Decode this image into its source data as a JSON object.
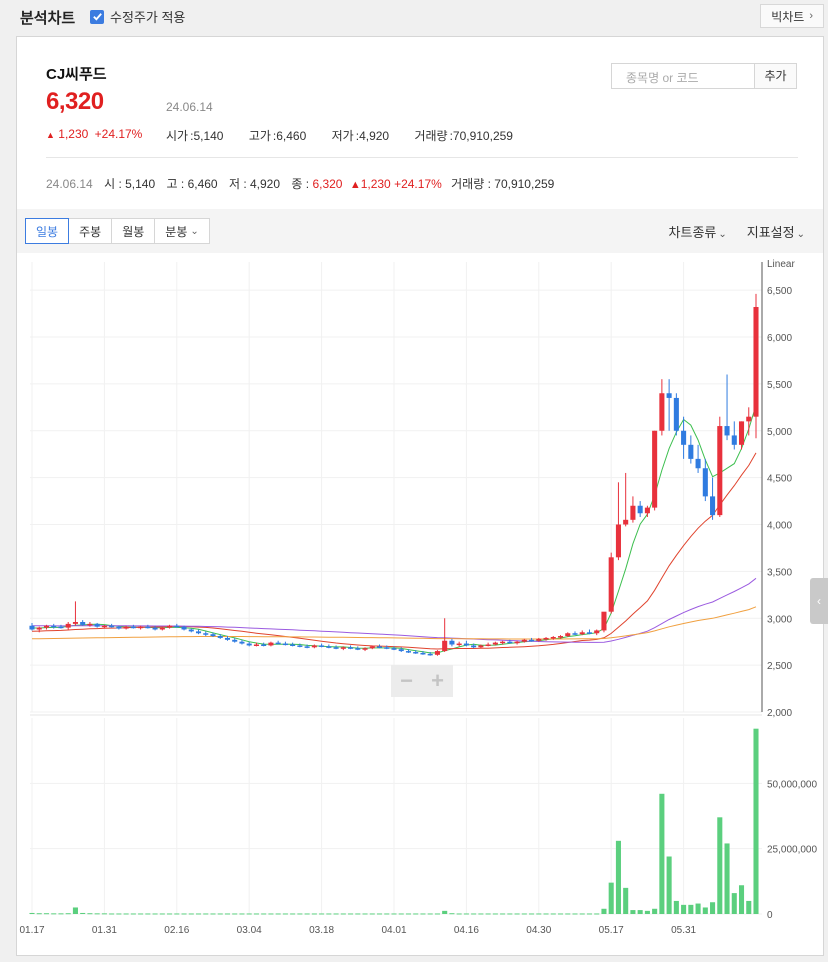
{
  "header": {
    "title": "분석차트",
    "adjusted_label": "수정주가 적용",
    "adjusted_checked": true,
    "bigchart_label": "빅차트"
  },
  "stock": {
    "name": "CJ씨푸드",
    "price": "6,320",
    "date": "24.06.14",
    "change": "1,230",
    "change_pct": "+24.17%",
    "open_label": "시가",
    "open": "5,140",
    "high_label": "고가",
    "high": "6,460",
    "low_label": "저가",
    "low": "4,920",
    "volume_label": "거래량",
    "volume": "70,910,259"
  },
  "search": {
    "placeholder": "종목명 or 코드",
    "add_label": "추가"
  },
  "ohlc_line": {
    "date": "24.06.14",
    "o_label": "시",
    "o": "5,140",
    "h_label": "고",
    "h": "6,460",
    "l_label": "저",
    "l": "4,920",
    "c_label": "종",
    "c": "6,320",
    "change": "1,230",
    "change_pct": "+24.17%",
    "v_label": "거래량",
    "v": "70,910,259"
  },
  "toolbar": {
    "periods": [
      "일봉",
      "주봉",
      "월봉",
      "분봉"
    ],
    "active_period": "일봉",
    "chart_type_label": "차트종류",
    "indicator_label": "지표설정"
  },
  "colors": {
    "up": "#e8313c",
    "down": "#2f7be0",
    "volume": "#5bcf7e",
    "ma5": "#3dbf4f",
    "ma20": "#e0442e",
    "ma60": "#9b5be0",
    "ma120": "#f0a040"
  },
  "chart_data": {
    "type": "candlestick",
    "scale_label": "Linear",
    "price_ticks": [
      2000,
      2500,
      3000,
      3500,
      4000,
      4500,
      5000,
      5500,
      6000,
      6500
    ],
    "price_tick_labels": [
      "2,000",
      "2,500",
      "3,000",
      "3,500",
      "4,000",
      "4,500",
      "5,000",
      "5,500",
      "6,000",
      "6,500"
    ],
    "ylim": [
      2000,
      6800
    ],
    "volume_ticks": [
      0,
      25000000,
      50000000
    ],
    "volume_tick_labels": [
      "0",
      "25,000,000",
      "50,000,000"
    ],
    "volume_ylim": [
      0,
      75000000
    ],
    "x_tick_labels": [
      "01.17",
      "01.31",
      "02.16",
      "03.04",
      "03.18",
      "04.01",
      "04.16",
      "04.30",
      "05.17",
      "05.31"
    ],
    "x_tick_index": [
      0,
      10,
      20,
      30,
      40,
      50,
      60,
      70,
      80,
      90
    ],
    "candles": [
      [
        2920,
        2950,
        2870,
        2880
      ],
      [
        2880,
        2910,
        2850,
        2900
      ],
      [
        2900,
        2930,
        2880,
        2920
      ],
      [
        2920,
        2940,
        2890,
        2910
      ],
      [
        2910,
        2930,
        2890,
        2900
      ],
      [
        2900,
        2960,
        2880,
        2940
      ],
      [
        2940,
        3180,
        2920,
        2960
      ],
      [
        2960,
        2980,
        2920,
        2930
      ],
      [
        2930,
        2960,
        2910,
        2940
      ],
      [
        2940,
        2950,
        2900,
        2910
      ],
      [
        2910,
        2930,
        2890,
        2920
      ],
      [
        2920,
        2940,
        2900,
        2910
      ],
      [
        2910,
        2920,
        2880,
        2890
      ],
      [
        2890,
        2920,
        2880,
        2910
      ],
      [
        2910,
        2930,
        2890,
        2900
      ],
      [
        2900,
        2920,
        2880,
        2910
      ],
      [
        2910,
        2930,
        2890,
        2900
      ],
      [
        2900,
        2920,
        2870,
        2880
      ],
      [
        2880,
        2910,
        2870,
        2900
      ],
      [
        2900,
        2930,
        2890,
        2920
      ],
      [
        2920,
        2940,
        2900,
        2910
      ],
      [
        2910,
        2920,
        2870,
        2880
      ],
      [
        2880,
        2890,
        2850,
        2860
      ],
      [
        2860,
        2880,
        2830,
        2840
      ],
      [
        2840,
        2860,
        2810,
        2830
      ],
      [
        2830,
        2850,
        2800,
        2810
      ],
      [
        2810,
        2830,
        2780,
        2790
      ],
      [
        2790,
        2810,
        2760,
        2770
      ],
      [
        2770,
        2790,
        2740,
        2750
      ],
      [
        2750,
        2770,
        2720,
        2730
      ],
      [
        2730,
        2750,
        2700,
        2710
      ],
      [
        2710,
        2740,
        2700,
        2720
      ],
      [
        2720,
        2740,
        2700,
        2710
      ],
      [
        2710,
        2750,
        2700,
        2740
      ],
      [
        2740,
        2760,
        2720,
        2730
      ],
      [
        2730,
        2750,
        2710,
        2720
      ],
      [
        2720,
        2740,
        2700,
        2710
      ],
      [
        2710,
        2730,
        2690,
        2700
      ],
      [
        2700,
        2720,
        2680,
        2690
      ],
      [
        2690,
        2720,
        2680,
        2710
      ],
      [
        2710,
        2730,
        2690,
        2700
      ],
      [
        2700,
        2720,
        2680,
        2690
      ],
      [
        2690,
        2710,
        2670,
        2680
      ],
      [
        2680,
        2700,
        2660,
        2690
      ],
      [
        2690,
        2710,
        2670,
        2680
      ],
      [
        2680,
        2700,
        2660,
        2670
      ],
      [
        2670,
        2690,
        2650,
        2680
      ],
      [
        2680,
        2710,
        2670,
        2700
      ],
      [
        2700,
        2720,
        2680,
        2690
      ],
      [
        2690,
        2710,
        2670,
        2680
      ],
      [
        2680,
        2700,
        2660,
        2670
      ],
      [
        2670,
        2690,
        2640,
        2650
      ],
      [
        2650,
        2670,
        2630,
        2640
      ],
      [
        2640,
        2660,
        2620,
        2630
      ],
      [
        2630,
        2650,
        2610,
        2620
      ],
      [
        2620,
        2640,
        2600,
        2610
      ],
      [
        2610,
        2660,
        2600,
        2650
      ],
      [
        2650,
        3000,
        2640,
        2760
      ],
      [
        2760,
        2780,
        2700,
        2720
      ],
      [
        2720,
        2750,
        2700,
        2730
      ],
      [
        2730,
        2760,
        2700,
        2710
      ],
      [
        2710,
        2730,
        2680,
        2690
      ],
      [
        2690,
        2720,
        2680,
        2710
      ],
      [
        2710,
        2740,
        2700,
        2720
      ],
      [
        2720,
        2750,
        2710,
        2740
      ],
      [
        2740,
        2760,
        2720,
        2750
      ],
      [
        2750,
        2770,
        2730,
        2740
      ],
      [
        2740,
        2760,
        2720,
        2750
      ],
      [
        2750,
        2780,
        2740,
        2770
      ],
      [
        2770,
        2790,
        2750,
        2760
      ],
      [
        2760,
        2790,
        2750,
        2780
      ],
      [
        2780,
        2800,
        2760,
        2790
      ],
      [
        2790,
        2810,
        2770,
        2800
      ],
      [
        2800,
        2820,
        2780,
        2810
      ],
      [
        2810,
        2850,
        2800,
        2840
      ],
      [
        2840,
        2860,
        2820,
        2830
      ],
      [
        2830,
        2870,
        2820,
        2850
      ],
      [
        2850,
        2880,
        2830,
        2840
      ],
      [
        2840,
        2880,
        2820,
        2870
      ],
      [
        2870,
        3000,
        2850,
        3070
      ],
      [
        3070,
        3700,
        3050,
        3650
      ],
      [
        3650,
        4450,
        3620,
        4000
      ],
      [
        4000,
        4550,
        3980,
        4050
      ],
      [
        4050,
        4300,
        4020,
        4200
      ],
      [
        4200,
        4250,
        4080,
        4120
      ],
      [
        4120,
        4200,
        4080,
        4180
      ],
      [
        4180,
        5000,
        4150,
        5000
      ],
      [
        5000,
        5550,
        4950,
        5400
      ],
      [
        5400,
        5550,
        5000,
        5350
      ],
      [
        5350,
        5400,
        4950,
        5000
      ],
      [
        5000,
        5150,
        4700,
        4850
      ],
      [
        4850,
        4950,
        4650,
        4700
      ],
      [
        4700,
        4850,
        4550,
        4600
      ],
      [
        4600,
        4700,
        4250,
        4300
      ],
      [
        4300,
        4500,
        4050,
        4100
      ],
      [
        4100,
        5150,
        4080,
        5050
      ],
      [
        5050,
        5600,
        4900,
        4950
      ],
      [
        4950,
        5100,
        4800,
        4850
      ],
      [
        4850,
        5100,
        4800,
        5100
      ],
      [
        5100,
        5250,
        4950,
        5150
      ],
      [
        5150,
        6460,
        4920,
        6320
      ]
    ],
    "volumes": [
      400000,
      300000,
      300000,
      250000,
      250000,
      300000,
      2500000,
      400000,
      300000,
      250000,
      250000,
      200000,
      200000,
      200000,
      200000,
      200000,
      200000,
      200000,
      200000,
      200000,
      200000,
      200000,
      200000,
      200000,
      200000,
      200000,
      200000,
      200000,
      200000,
      200000,
      200000,
      200000,
      200000,
      200000,
      200000,
      200000,
      200000,
      200000,
      200000,
      200000,
      200000,
      200000,
      200000,
      200000,
      200000,
      200000,
      200000,
      200000,
      200000,
      200000,
      200000,
      200000,
      200000,
      200000,
      200000,
      200000,
      200000,
      1200000,
      300000,
      200000,
      200000,
      200000,
      200000,
      200000,
      200000,
      200000,
      200000,
      200000,
      200000,
      200000,
      200000,
      200000,
      200000,
      200000,
      200000,
      200000,
      200000,
      200000,
      200000,
      2000000,
      12000000,
      28000000,
      10000000,
      1500000,
      1500000,
      1200000,
      2000000,
      46000000,
      22000000,
      5000000,
      3500000,
      3500000,
      4000000,
      2500000,
      4500000,
      37000000,
      27000000,
      8000000,
      11000000,
      5000000,
      70910259
    ]
  }
}
